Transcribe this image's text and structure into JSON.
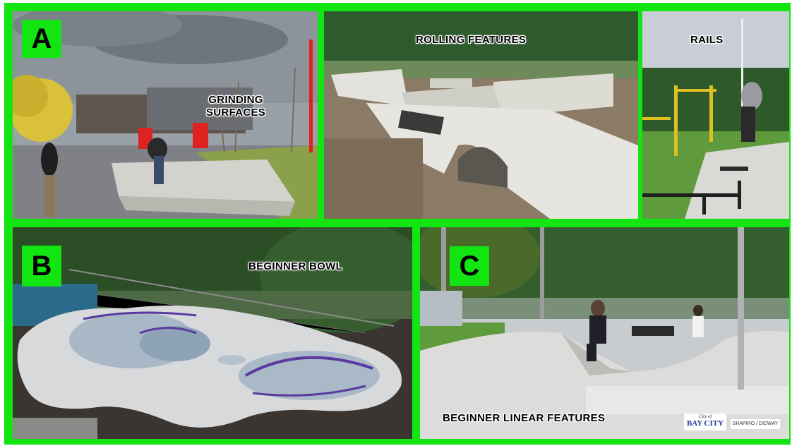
{
  "colors": {
    "frame": "#12e512",
    "badge": "#12e512"
  },
  "panels": {
    "grinding": {
      "badge": "A",
      "caption_line1": "GRINDING",
      "caption_line2": "SURFACES"
    },
    "rolling": {
      "caption": "ROLLING  FEATURES"
    },
    "rails": {
      "caption": "RAILS"
    },
    "bowl": {
      "badge": "B",
      "caption": "BEGINNER BOWL"
    },
    "linear": {
      "badge": "C",
      "caption": "BEGINNER LINEAR FEATURES"
    }
  },
  "logos": {
    "city_script": "City of",
    "city_name": "BAY CITY",
    "firm": "SHAPIRO / DIDWAY"
  }
}
